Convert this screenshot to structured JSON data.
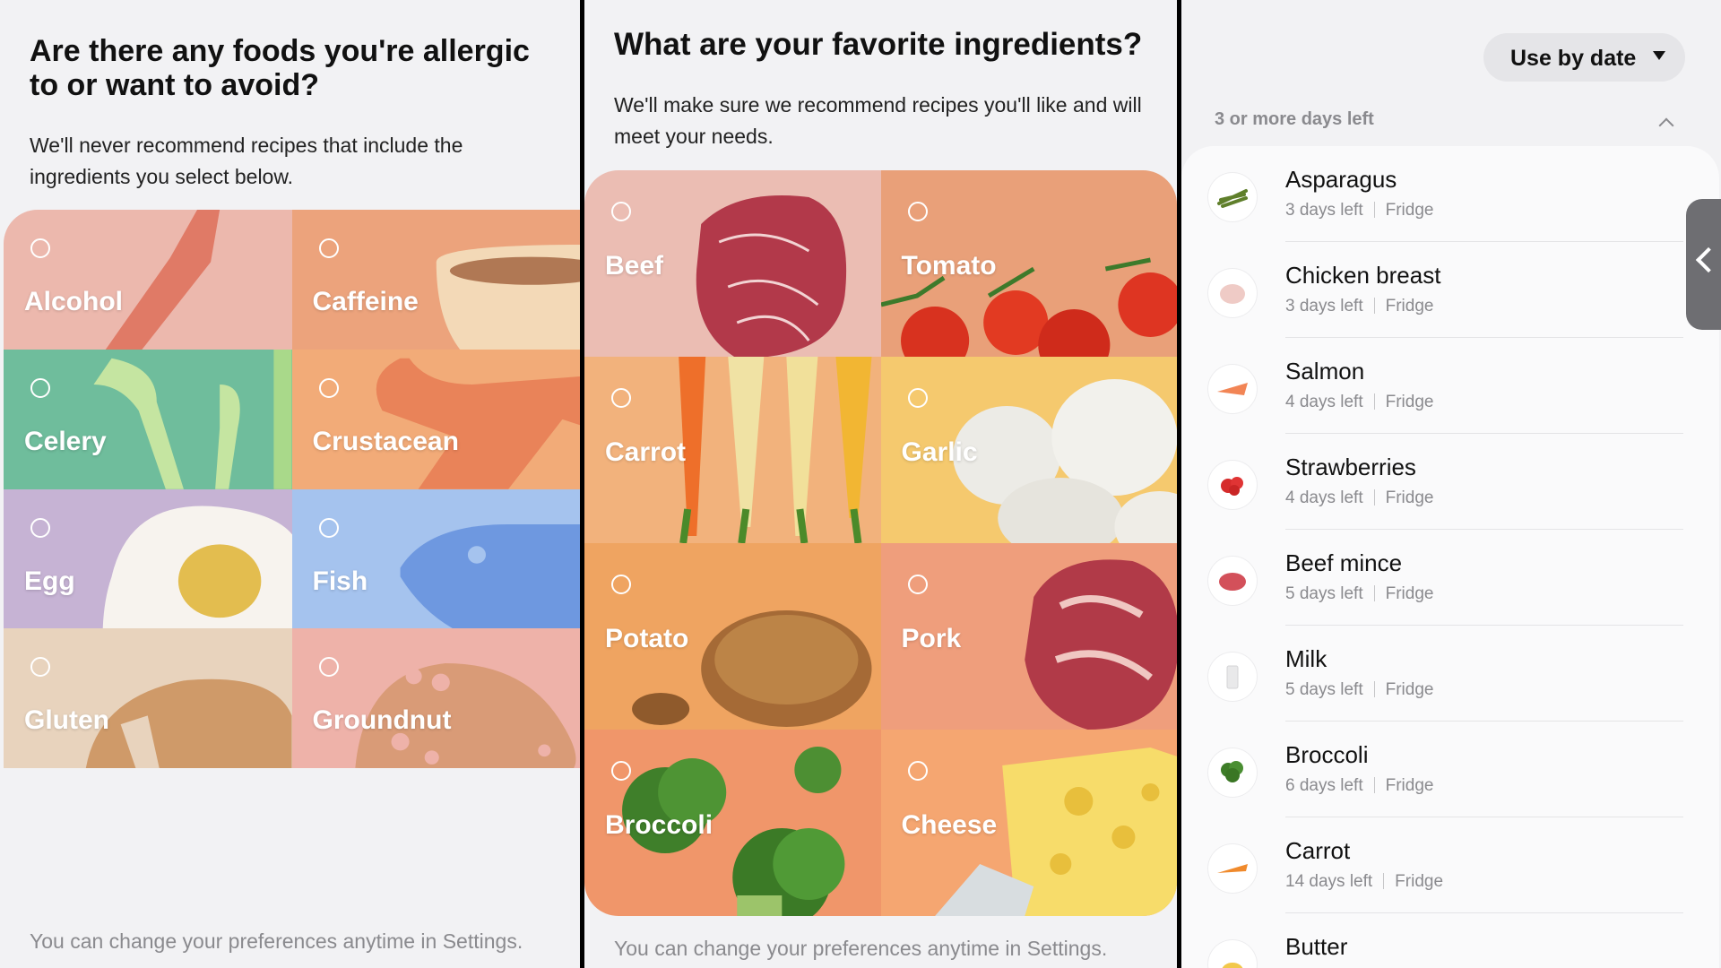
{
  "allergy_screen": {
    "title": "Are there any foods you're allergic to or want to avoid?",
    "description": "We'll never recommend recipes that include the ingredients you select below.",
    "options": [
      "Alcohol",
      "Caffeine",
      "Celery",
      "Crustacean",
      "Egg",
      "Fish",
      "Gluten",
      "Groundnut"
    ],
    "footer": "You can change your preferences anytime in Settings."
  },
  "favorites_screen": {
    "title": "What are your favorite ingredients?",
    "description": "We'll make sure we recommend recipes you'll like and will meet your needs.",
    "options": [
      "Beef",
      "Tomato",
      "Carrot",
      "Garlic",
      "Potato",
      "Pork",
      "Broccoli",
      "Cheese"
    ],
    "footer": "You can change your preferences anytime in Settings."
  },
  "inventory_screen": {
    "sort_label": "Use by date",
    "section_label": "3 or more days left",
    "items": [
      {
        "name": "Asparagus",
        "days": "3 days left",
        "location": "Fridge",
        "icon": "asparagus-icon"
      },
      {
        "name": "Chicken breast",
        "days": "3 days left",
        "location": "Fridge",
        "icon": "chicken-breast-icon"
      },
      {
        "name": "Salmon",
        "days": "4 days left",
        "location": "Fridge",
        "icon": "salmon-icon"
      },
      {
        "name": "Strawberries",
        "days": "4 days left",
        "location": "Fridge",
        "icon": "strawberries-icon"
      },
      {
        "name": "Beef mince",
        "days": "5 days left",
        "location": "Fridge",
        "icon": "beef-mince-icon"
      },
      {
        "name": "Milk",
        "days": "5 days left",
        "location": "Fridge",
        "icon": "milk-icon"
      },
      {
        "name": "Broccoli",
        "days": "6 days left",
        "location": "Fridge",
        "icon": "broccoli-icon"
      },
      {
        "name": "Carrot",
        "days": "14 days left",
        "location": "Fridge",
        "icon": "carrot-icon"
      },
      {
        "name": "Butter",
        "days": "",
        "location": "",
        "icon": "butter-icon"
      }
    ]
  },
  "colors": {
    "alcohol_bg": "#ecb8ad",
    "caffeine_bg": "#eca37c",
    "celery_bg": "#6fbd9c",
    "crustacean_bg": "#f2ab78",
    "egg_bg": "#c6b3d4",
    "fish_bg": "#a5c3ee",
    "gluten_bg": "#e8d3bd",
    "groundnut_bg": "#eeb2a9",
    "beef_bg": "#ebbdb3",
    "tomato_bg": "#e9a079",
    "carrot_bg": "#f2b27c",
    "garlic_bg": "#f5c96e",
    "potato_bg": "#efa461",
    "pork_bg": "#ef9e7c",
    "broccoli_bg": "#f0966a",
    "cheese_bg": "#f5a671"
  }
}
